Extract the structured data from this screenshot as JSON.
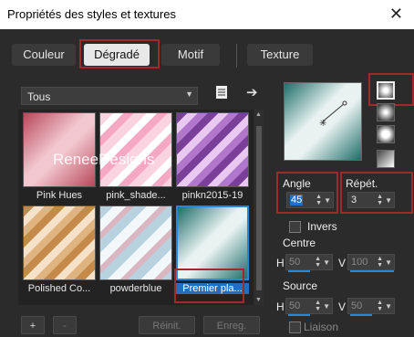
{
  "window": {
    "title": "Propriétés des styles et textures",
    "close_label": "✕"
  },
  "tabs": [
    {
      "label": "Couleur"
    },
    {
      "label": "Dégradé"
    },
    {
      "label": "Motif"
    },
    {
      "label": "Texture"
    }
  ],
  "gradient_list": {
    "category": "Tous",
    "items": [
      {
        "label": "Pink Hues"
      },
      {
        "label": "pink_shade..."
      },
      {
        "label": "pinkn2015-19"
      },
      {
        "label": "Polished Co..."
      },
      {
        "label": "powderblue"
      },
      {
        "label": "Premier pla..."
      }
    ],
    "selected_index": 5,
    "watermark": "ReneeDesigns"
  },
  "footer_buttons": {
    "add": "+",
    "remove": "-",
    "reset": "Réinit.",
    "save": "Enreg."
  },
  "properties": {
    "angle_label": "Angle",
    "angle_value": "45",
    "repeat_label": "Répét.",
    "repeat_value": "3",
    "invert_label": "Invers",
    "center_label": "Centre",
    "center_h_label": "H",
    "center_h_value": "50",
    "center_v_label": "V",
    "center_v_value": "100",
    "source_label": "Source",
    "source_h_label": "H",
    "source_h_value": "50",
    "source_v_label": "V",
    "source_v_value": "50",
    "link_label": "Liaison"
  },
  "colors": {
    "accent": "#1f8ae0",
    "highlight": "#a02a2a",
    "gradient_dark": "#1e6e6a",
    "gradient_light": "#e8f2f0"
  }
}
